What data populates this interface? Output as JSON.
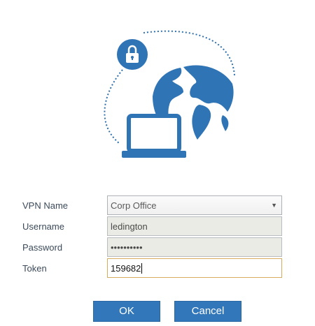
{
  "form": {
    "vpn_name": {
      "label": "VPN Name",
      "value": "Corp Office"
    },
    "username": {
      "label": "Username",
      "value": "ledington"
    },
    "password": {
      "label": "Password",
      "value": "••••••••••"
    },
    "token": {
      "label": "Token",
      "value": "159682"
    }
  },
  "buttons": {
    "ok": "OK",
    "cancel": "Cancel"
  },
  "icons": {
    "hero": "vpn-illustration",
    "lock": "lock-icon",
    "globe": "globe-icon",
    "laptop": "laptop-icon",
    "dropdown": "chevron-down-icon"
  },
  "colors": {
    "accent": "#3277b9",
    "token_border": "#d6ad5f",
    "readonly_field": "#ebebe6"
  }
}
